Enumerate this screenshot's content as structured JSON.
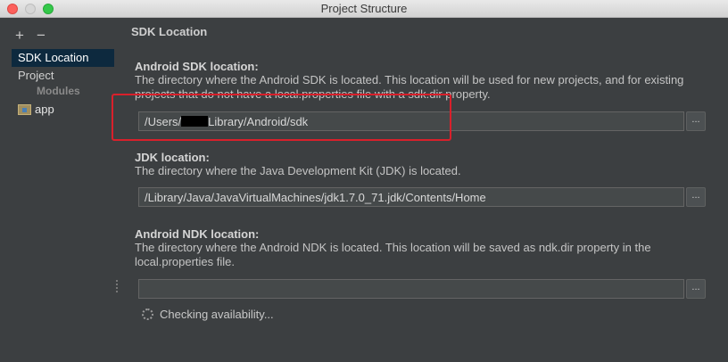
{
  "window": {
    "title": "Project Structure"
  },
  "sidebar": {
    "add_label": "+",
    "remove_label": "−",
    "items": [
      {
        "label": "SDK Location",
        "selected": true
      },
      {
        "label": "Project"
      }
    ],
    "modules_header": "Modules",
    "modules": [
      {
        "label": "app",
        "icon": "module-folder-icon"
      }
    ]
  },
  "main": {
    "title": "SDK Location",
    "android_sdk": {
      "label": "Android SDK location:",
      "description": "The directory where the Android SDK is located. This location will be used for new projects, and for existing projects that do not have a local.properties file with a sdk.dir property.",
      "path_prefix": "/Users/",
      "path_suffix": "Library/Android/sdk",
      "browse_label": "..."
    },
    "jdk": {
      "label": "JDK location:",
      "description": "The directory where the Java Development Kit (JDK) is located.",
      "path": "/Library/Java/JavaVirtualMachines/jdk1.7.0_71.jdk/Contents/Home",
      "browse_label": "..."
    },
    "android_ndk": {
      "label": "Android NDK location:",
      "description": "The directory where the Android NDK is located. This location will be saved as ndk.dir property in the local.properties file.",
      "path": "",
      "browse_label": "..."
    },
    "status": {
      "text": "Checking availability...",
      "icon": "spinner-icon"
    }
  },
  "colors": {
    "background": "#3c3f41",
    "selection": "#0d293e",
    "highlight_annotation": "#d9202b"
  }
}
